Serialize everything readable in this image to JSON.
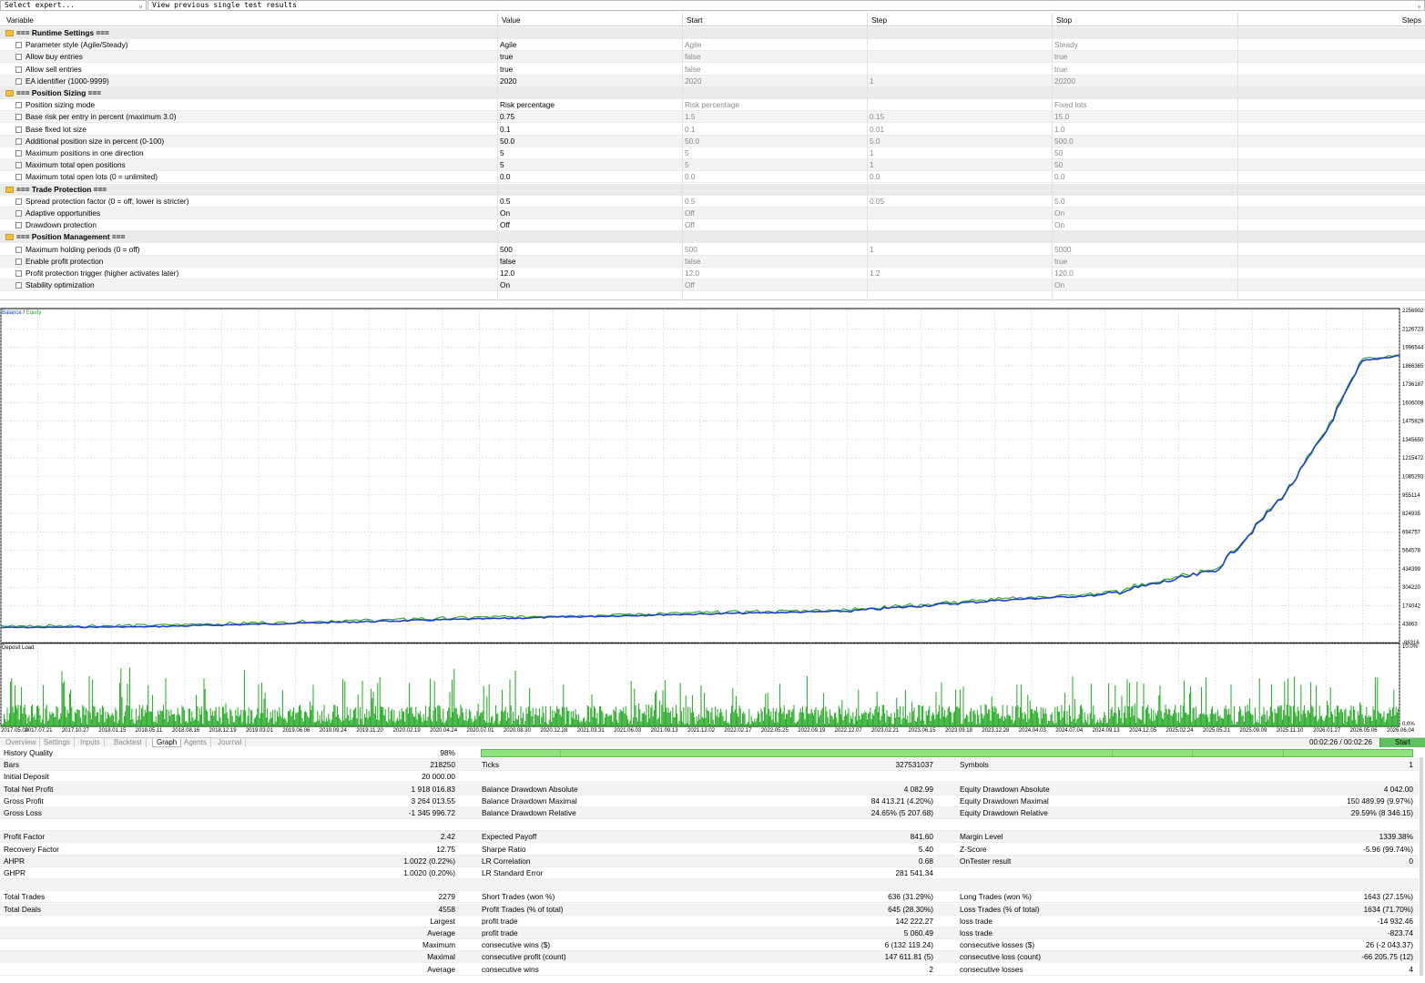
{
  "top": {
    "expert_placeholder": "Select expert...",
    "results_label": "View previous single test results"
  },
  "inputs_header": {
    "variable": "Variable",
    "value": "Value",
    "start": "Start",
    "step": "Step",
    "stop": "Stop",
    "steps": "Steps"
  },
  "inputs": [
    {
      "group": true,
      "name": "=== Runtime Settings ==="
    },
    {
      "name": "Parameter style (Agile/Steady)",
      "value": "Agile",
      "start": "Agile",
      "step": "",
      "stop": "Steady"
    },
    {
      "name": "Allow buy entries",
      "value": "true",
      "start": "false",
      "step": "",
      "stop": "true"
    },
    {
      "name": "Allow sell entries",
      "value": "true",
      "start": "false",
      "step": "",
      "stop": "true"
    },
    {
      "name": "EA identifier (1000-9999)",
      "value": "2020",
      "start": "2020",
      "step": "1",
      "stop": "20200"
    },
    {
      "group": true,
      "name": "=== Position Sizing ==="
    },
    {
      "name": "Position sizing mode",
      "value": "Risk percentage",
      "start": "Risk percentage",
      "step": "",
      "stop": "Fixed lots"
    },
    {
      "name": "Base risk per entry in percent (maximum 3.0)",
      "value": "0.75",
      "start": "1.5",
      "step": "0.15",
      "stop": "15.0"
    },
    {
      "name": "Base fixed lot size",
      "value": "0.1",
      "start": "0.1",
      "step": "0.01",
      "stop": "1.0"
    },
    {
      "name": "Additional position size in percent (0-100)",
      "value": "50.0",
      "start": "50.0",
      "step": "5.0",
      "stop": "500.0"
    },
    {
      "name": "Maximum positions in one direction",
      "value": "5",
      "start": "5",
      "step": "1",
      "stop": "50"
    },
    {
      "name": "Maximum total open positions",
      "value": "5",
      "start": "5",
      "step": "1",
      "stop": "50"
    },
    {
      "name": "Maximum total open lots (0 = unlimited)",
      "value": "0.0",
      "start": "0.0",
      "step": "0.0",
      "stop": "0.0"
    },
    {
      "group": true,
      "name": "=== Trade Protection ==="
    },
    {
      "name": "Spread protection factor (0 = off; lower is stricter)",
      "value": "0.5",
      "start": "0.5",
      "step": "0.05",
      "stop": "5.0"
    },
    {
      "name": "Adaptive opportunities",
      "value": "On",
      "start": "Off",
      "step": "",
      "stop": "On"
    },
    {
      "name": "Drawdown protection",
      "value": "Off",
      "start": "Off",
      "step": "",
      "stop": "On"
    },
    {
      "group": true,
      "name": "=== Position Management ==="
    },
    {
      "name": "Maximum holding periods (0 = off)",
      "value": "500",
      "start": "500",
      "step": "1",
      "stop": "5000"
    },
    {
      "name": "Enable profit protection",
      "value": "false",
      "start": "false",
      "step": "",
      "stop": "true"
    },
    {
      "name": "Profit protection trigger (higher activates later)",
      "value": "12.0",
      "start": "12.0",
      "step": "1.2",
      "stop": "120.0"
    },
    {
      "name": "Stability optimization",
      "value": "On",
      "start": "Off",
      "step": "",
      "stop": "On"
    }
  ],
  "chart_data": [
    {
      "type": "line",
      "legend": {
        "balance": "Balance",
        "separator": " / ",
        "equity": "Equity"
      },
      "series": [
        {
          "name": "Balance"
        },
        {
          "name": "Equity"
        }
      ],
      "x": [
        "2017.05.08",
        "2018.05.11",
        "2019.06.06",
        "2020.07.01",
        "2021.09.13",
        "2022.12.07",
        "2023.12.28",
        "2024.09.13",
        "2025.05.21",
        "2025.09.09",
        "2025.11.10",
        "2026.01.27",
        "2026.05.06",
        "2026.06.04"
      ],
      "y": [
        20000,
        25000,
        50000,
        80000,
        110000,
        135000,
        210000,
        250000,
        420000,
        700000,
        1000000,
        1400000,
        1900000,
        1938000
      ],
      "ylim": [
        -86316,
        2256902
      ],
      "yticks": [
        "2256902",
        "2126723",
        "1996544",
        "1866365",
        "1736187",
        "1606008",
        "1475829",
        "1345650",
        "1215472",
        "1085293",
        "955114",
        "824935",
        "694757",
        "564578",
        "434399",
        "304220",
        "174042",
        "43863",
        "-86316"
      ],
      "grid": true,
      "colors": {
        "balance": "#1f3fc8",
        "equity": "#28a828"
      }
    },
    {
      "type": "bar",
      "title": "Deposit Load",
      "ylim": [
        0,
        10
      ],
      "yticks": [
        "10.0%",
        "0.0%"
      ],
      "xticks": [
        "2017.05.08",
        "2017.07.21",
        "2017.10.27",
        "2018.01.15",
        "2018.05.11",
        "2018.08.16",
        "2018.12.19",
        "2019.03.01",
        "2019.06.06",
        "2019.09.24",
        "2019.11.20",
        "2020.02.19",
        "2020.04.24",
        "2020.07.01",
        "2020.08.30",
        "2020.12.28",
        "2021.03.31",
        "2021.06.03",
        "2021.09.13",
        "2021.12.02",
        "2022.02.17",
        "2022.05.25",
        "2022.09.19",
        "2022.12.07",
        "2023.02.21",
        "2023.06.15",
        "2023.09.18",
        "2023.12.28",
        "2024.04.03",
        "2024.07.04",
        "2024.09.13",
        "2024.12.05",
        "2025.02.24",
        "2025.05.21",
        "2025.09.09",
        "2025.11.10",
        "2026.01.27",
        "2026.05.06",
        "2026.06.04"
      ],
      "color": "#1fa81f"
    }
  ],
  "tabs": [
    "Overview",
    "Settings",
    "Inputs",
    "Backtest",
    "Graph",
    "Agents",
    "Journal"
  ],
  "active_tab": "Graph",
  "timer": "00:02:26 / 00:02:26",
  "start_button": "Start",
  "results": [
    {
      "l1": "History Quality",
      "v1": "98%",
      "bar": true
    },
    {
      "l1": "Bars",
      "v1": "218250",
      "l2": "Ticks",
      "v2": "327531037",
      "l3": "Symbols",
      "v3": "1"
    },
    {
      "l1": "Initial Deposit",
      "v1": "20 000.00"
    },
    {
      "l1": "Total Net Profit",
      "v1": "1 918 016.83",
      "l2": "Balance Drawdown Absolute",
      "v2": "4 082.99",
      "l3": "Equity Drawdown Absolute",
      "v3": "4 042.00"
    },
    {
      "l1": "Gross Profit",
      "v1": "3 264 013.55",
      "l2": "Balance Drawdown Maximal",
      "v2": "84 413.21 (4.20%)",
      "l3": "Equity Drawdown Maximal",
      "v3": "150 489.99 (9.97%)"
    },
    {
      "l1": "Gross Loss",
      "v1": "-1 345 996.72",
      "l2": "Balance Drawdown Relative",
      "v2": "24.65% (5 207.68)",
      "l3": "Equity Drawdown Relative",
      "v3": "29.59% (8 346.15)"
    },
    {},
    {
      "l1": "Profit Factor",
      "v1": "2.42",
      "l2": "Expected Payoff",
      "v2": "841.60",
      "l3": "Margin Level",
      "v3": "1339.38%"
    },
    {
      "l1": "Recovery Factor",
      "v1": "12.75",
      "l2": "Sharpe Ratio",
      "v2": "5.40",
      "l3": "Z-Score",
      "v3": "-5.96 (99.74%)"
    },
    {
      "l1": "AHPR",
      "v1": "1.0022 (0.22%)",
      "l2": "LR Correlation",
      "v2": "0.68",
      "l3": "OnTester result",
      "v3": "0"
    },
    {
      "l1": "GHPR",
      "v1": "1.0020 (0.20%)",
      "l2": "LR Standard Error",
      "v2": "281 541.34"
    },
    {},
    {
      "l1": "Total Trades",
      "v1": "2279",
      "l2": "Short Trades (won %)",
      "v2": "636 (31.29%)",
      "l3": "Long Trades (won %)",
      "v3": "1643 (27.15%)"
    },
    {
      "l1": "Total Deals",
      "v1": "4558",
      "l2": "Profit Trades (% of total)",
      "v2": "645 (28.30%)",
      "l3": "Loss Trades (% of total)",
      "v3": "1634 (71.70%)"
    },
    {
      "v1": "Largest",
      "l2": "profit trade",
      "v2": "142 222.27",
      "l3": "loss trade",
      "v3": "-14 932.46"
    },
    {
      "v1": "Average",
      "l2": "profit trade",
      "v2": "5 060.49",
      "l3": "loss trade",
      "v3": "-823.74"
    },
    {
      "v1": "Maximum",
      "l2": "consecutive wins ($)",
      "v2": "6 (132 119.24)",
      "l3": "consecutive losses ($)",
      "v3": "26 (-2 043.37)"
    },
    {
      "v1": "Maximal",
      "l2": "consecutive profit (count)",
      "v2": "147 611.81 (5)",
      "l3": "consecutive loss (count)",
      "v3": "-66 205.75 (12)"
    },
    {
      "v1": "Average",
      "l2": "consecutive wins",
      "v2": "2",
      "l3": "consecutive losses",
      "v3": "4"
    }
  ]
}
